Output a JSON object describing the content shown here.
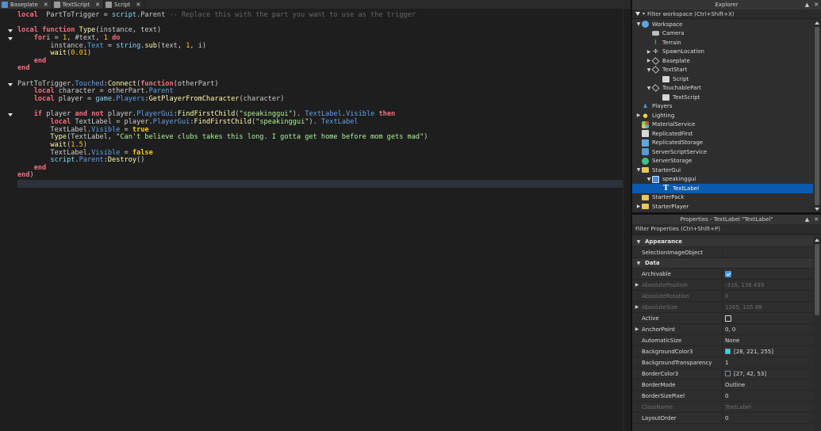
{
  "tabs": [
    {
      "label": "Baseplate",
      "icon": "place-icon",
      "active": false
    },
    {
      "label": "TextScript",
      "icon": "script-icon",
      "active": false
    },
    {
      "label": "Script",
      "icon": "script-icon",
      "active": true
    }
  ],
  "tab_close_glyph": "✕",
  "code_lines": [
    [
      [
        "kw",
        "local"
      ],
      [
        "",
        "  PartToTrigger = "
      ],
      [
        "bi",
        "script"
      ],
      [
        "",
        ".Parent "
      ],
      [
        "cm",
        "-- Replace this with the part you want to use as the trigger"
      ]
    ],
    [],
    [
      [
        "kw",
        "local"
      ],
      [
        "",
        " "
      ],
      [
        "kw",
        "function"
      ],
      [
        "",
        " "
      ],
      [
        "fn",
        "Type"
      ],
      [
        "",
        "(instance, text)"
      ]
    ],
    [
      [
        "",
        "    "
      ],
      [
        "kw",
        "for"
      ],
      [
        "",
        "",
        " "
      ],
      [
        "",
        "i = "
      ],
      [
        "num",
        "1"
      ],
      [
        "",
        ", #text, "
      ],
      [
        "num",
        "1"
      ],
      [
        "",
        " "
      ],
      [
        "kw",
        "do"
      ]
    ],
    [
      [
        "",
        "        instance."
      ],
      [
        "prop",
        "Text"
      ],
      [
        "",
        " = "
      ],
      [
        "bi",
        "string"
      ],
      [
        "",
        "."
      ],
      [
        "fn",
        "sub"
      ],
      [
        "",
        "(text, "
      ],
      [
        "num",
        "1"
      ],
      [
        "",
        ", i)"
      ]
    ],
    [
      [
        "",
        "        "
      ],
      [
        "fn",
        "wait"
      ],
      [
        "",
        "("
      ],
      [
        "num",
        "0.01"
      ],
      [
        "",
        ")"
      ]
    ],
    [
      [
        "",
        "    "
      ],
      [
        "kw",
        "end"
      ]
    ],
    [
      [
        "kw",
        "end"
      ]
    ],
    [],
    [
      [
        "",
        "PartToTrigger."
      ],
      [
        "prop",
        "Touched"
      ],
      [
        "",
        ":"
      ],
      [
        "fn",
        "Connect"
      ],
      [
        "",
        "("
      ],
      [
        "kw",
        "function"
      ],
      [
        "",
        "(otherPart)"
      ]
    ],
    [
      [
        "",
        "    "
      ],
      [
        "kw",
        "local"
      ],
      [
        "",
        " character = otherPart."
      ],
      [
        "prop",
        "Parent"
      ]
    ],
    [
      [
        "",
        "    "
      ],
      [
        "kw",
        "local"
      ],
      [
        "",
        " player = "
      ],
      [
        "bi",
        "game"
      ],
      [
        "",
        "."
      ],
      [
        "prop",
        "Players"
      ],
      [
        "",
        ":"
      ],
      [
        "fn",
        "GetPlayerFromCharacter"
      ],
      [
        "",
        "(character)"
      ]
    ],
    [],
    [
      [
        "",
        "    "
      ],
      [
        "kw",
        "if"
      ],
      [
        "",
        " player "
      ],
      [
        "kw",
        "and"
      ],
      [
        "",
        " "
      ],
      [
        "kw",
        "not"
      ],
      [
        "",
        " player."
      ],
      [
        "prop",
        "PlayerGui"
      ],
      [
        "",
        ":"
      ],
      [
        "fn",
        "FindFirstChild"
      ],
      [
        "",
        "("
      ],
      [
        "str",
        "\"speakinggui\""
      ],
      [
        "",
        "). "
      ],
      [
        "prop",
        "TextLabel"
      ],
      [
        "",
        "."
      ],
      [
        "prop",
        "Visible"
      ],
      [
        "",
        " "
      ],
      [
        "kw",
        "then"
      ]
    ],
    [
      [
        "",
        "        "
      ],
      [
        "kw",
        "local"
      ],
      [
        "",
        " TextLabel = player."
      ],
      [
        "prop",
        "PlayerGui"
      ],
      [
        "",
        ":"
      ],
      [
        "fn",
        "FindFirstChild"
      ],
      [
        "",
        "("
      ],
      [
        "str",
        "\"speakinggui\""
      ],
      [
        "",
        "). "
      ],
      [
        "prop",
        "TextLabel"
      ]
    ],
    [
      [
        "",
        "        TextLabel."
      ],
      [
        "prop",
        "Visible"
      ],
      [
        "",
        " = "
      ],
      [
        "bool",
        "true"
      ]
    ],
    [
      [
        "",
        "        "
      ],
      [
        "fn",
        "Type"
      ],
      [
        "",
        "(TextLabel, "
      ],
      [
        "str",
        "\"Can't believe clubs takes this long. I gotta get home before mom gets mad\""
      ],
      [
        "",
        ")"
      ]
    ],
    [
      [
        "",
        "        "
      ],
      [
        "fn",
        "wait"
      ],
      [
        "",
        "("
      ],
      [
        "num",
        "1.5"
      ],
      [
        "",
        ")"
      ]
    ],
    [
      [
        "",
        "        TextLabel."
      ],
      [
        "prop",
        "Visible"
      ],
      [
        "",
        " = "
      ],
      [
        "bool",
        "false"
      ]
    ],
    [
      [
        "",
        "        "
      ],
      [
        "bi",
        "script"
      ],
      [
        "",
        "."
      ],
      [
        "prop",
        "Parent"
      ],
      [
        "",
        ":"
      ],
      [
        "fn",
        "Destroy"
      ],
      [
        "",
        "()"
      ]
    ],
    [
      [
        "",
        "    "
      ],
      [
        "kw",
        "end"
      ]
    ],
    [
      [
        "kw",
        "end"
      ],
      [
        "",
        ")"
      ]
    ],
    []
  ],
  "fold_lines": [
    2,
    3,
    9,
    13
  ],
  "current_line": 22,
  "explorer": {
    "title": "Explorer",
    "filter_placeholder": "Filter workspace (Ctrl+Shift+X)",
    "ctrl_expand": "▲",
    "ctrl_close": "✕",
    "nodes": [
      {
        "label": "Workspace",
        "depth": 0,
        "arrow": "▼",
        "icon": "globe-icon",
        "cls": "i-globe"
      },
      {
        "label": "Camera",
        "depth": 1,
        "arrow": "",
        "icon": "camera-icon",
        "cls": "i-cam"
      },
      {
        "label": "Terrain",
        "depth": 1,
        "arrow": "",
        "icon": "terrain-icon",
        "cls": "i-terrain",
        "glyph": "⌇"
      },
      {
        "label": "SpawnLocation",
        "depth": 1,
        "arrow": "▶",
        "icon": "spawn-icon",
        "cls": "i-spawn",
        "glyph": "✣"
      },
      {
        "label": "Baseplate",
        "depth": 1,
        "arrow": "▶",
        "icon": "part-icon",
        "cls": "i-cube"
      },
      {
        "label": "TextStart",
        "depth": 1,
        "arrow": "▼",
        "icon": "part-icon",
        "cls": "i-cube"
      },
      {
        "label": "Script",
        "depth": 2,
        "arrow": "",
        "icon": "script-icon",
        "cls": "i-script"
      },
      {
        "label": "TouchablePart",
        "depth": 1,
        "arrow": "▼",
        "icon": "part-icon",
        "cls": "i-cube"
      },
      {
        "label": "TextScript",
        "depth": 2,
        "arrow": "",
        "icon": "script-icon",
        "cls": "i-script"
      },
      {
        "label": "Players",
        "depth": 0,
        "arrow": "",
        "icon": "players-icon",
        "cls": "i-players",
        "glyph": "♟"
      },
      {
        "label": "Lighting",
        "depth": 0,
        "arrow": "▶",
        "icon": "lightbulb-icon",
        "cls": "i-light",
        "glyph": "●"
      },
      {
        "label": "MaterialService",
        "depth": 0,
        "arrow": "",
        "icon": "material-icon",
        "cls": "i-mat"
      },
      {
        "label": "ReplicatedFirst",
        "depth": 0,
        "arrow": "",
        "icon": "replicated-first-icon",
        "cls": "i-rep"
      },
      {
        "label": "ReplicatedStorage",
        "depth": 0,
        "arrow": "",
        "icon": "replicated-storage-icon",
        "cls": "i-repS"
      },
      {
        "label": "ServerScriptService",
        "depth": 0,
        "arrow": "",
        "icon": "server-script-service-icon",
        "cls": "i-sss"
      },
      {
        "label": "ServerStorage",
        "depth": 0,
        "arrow": "",
        "icon": "server-storage-icon",
        "cls": "i-ss"
      },
      {
        "label": "StarterGui",
        "depth": 0,
        "arrow": "▼",
        "icon": "folder-icon",
        "cls": "i-folder"
      },
      {
        "label": "speakinggui",
        "depth": 1,
        "arrow": "▼",
        "icon": "screengui-icon",
        "cls": "i-gui"
      },
      {
        "label": "TextLabel",
        "depth": 2,
        "arrow": "",
        "icon": "textlabel-icon",
        "cls": "i-text",
        "glyph": "T",
        "selected": true
      },
      {
        "label": "StarterPack",
        "depth": 0,
        "arrow": "",
        "icon": "folder-icon",
        "cls": "i-folder"
      },
      {
        "label": "StarterPlayer",
        "depth": 0,
        "arrow": "▶",
        "icon": "folder-icon",
        "cls": "i-folder"
      }
    ]
  },
  "properties": {
    "title": "Properties - TextLabel \"TextLabel\"",
    "filter_placeholder": "Filter Properties (Ctrl+Shift+P)",
    "ctrl_expand": "▲",
    "ctrl_close": "✕",
    "rows": [
      {
        "kind": "cat",
        "label": "Appearance"
      },
      {
        "kind": "prop",
        "name": "SelectionImageObject",
        "value": ""
      },
      {
        "kind": "cat",
        "label": "Data"
      },
      {
        "kind": "prop",
        "name": "Archivable",
        "checkbox": true,
        "checked": true
      },
      {
        "kind": "prop",
        "name": "AbsolutePosition",
        "value": "-316, 138.439",
        "dim": true,
        "expand": true
      },
      {
        "kind": "prop",
        "name": "AbsoluteRotation",
        "value": "0",
        "dim": true
      },
      {
        "kind": "prop",
        "name": "AbsoluteSize",
        "value": "1265, 105.88",
        "dim": true,
        "expand": true
      },
      {
        "kind": "prop",
        "name": "Active",
        "checkbox": true,
        "checked": false
      },
      {
        "kind": "prop",
        "name": "AnchorPoint",
        "value": "0, 0",
        "expand": true
      },
      {
        "kind": "prop",
        "name": "AutomaticSize",
        "value": "None"
      },
      {
        "kind": "prop",
        "name": "BackgroundColor3",
        "value": "[28, 221, 255]",
        "swatch": "#1cddff"
      },
      {
        "kind": "prop",
        "name": "BackgroundTransparency",
        "value": "1"
      },
      {
        "kind": "prop",
        "name": "BorderColor3",
        "value": "[27, 42, 53]",
        "swatch": "#1b2a35"
      },
      {
        "kind": "prop",
        "name": "BorderMode",
        "value": "Outline"
      },
      {
        "kind": "prop",
        "name": "BorderSizePixel",
        "value": "0"
      },
      {
        "kind": "prop",
        "name": "ClassName",
        "value": "TextLabel",
        "dim": true
      },
      {
        "kind": "prop",
        "name": "LayoutOrder",
        "value": "0"
      }
    ]
  }
}
